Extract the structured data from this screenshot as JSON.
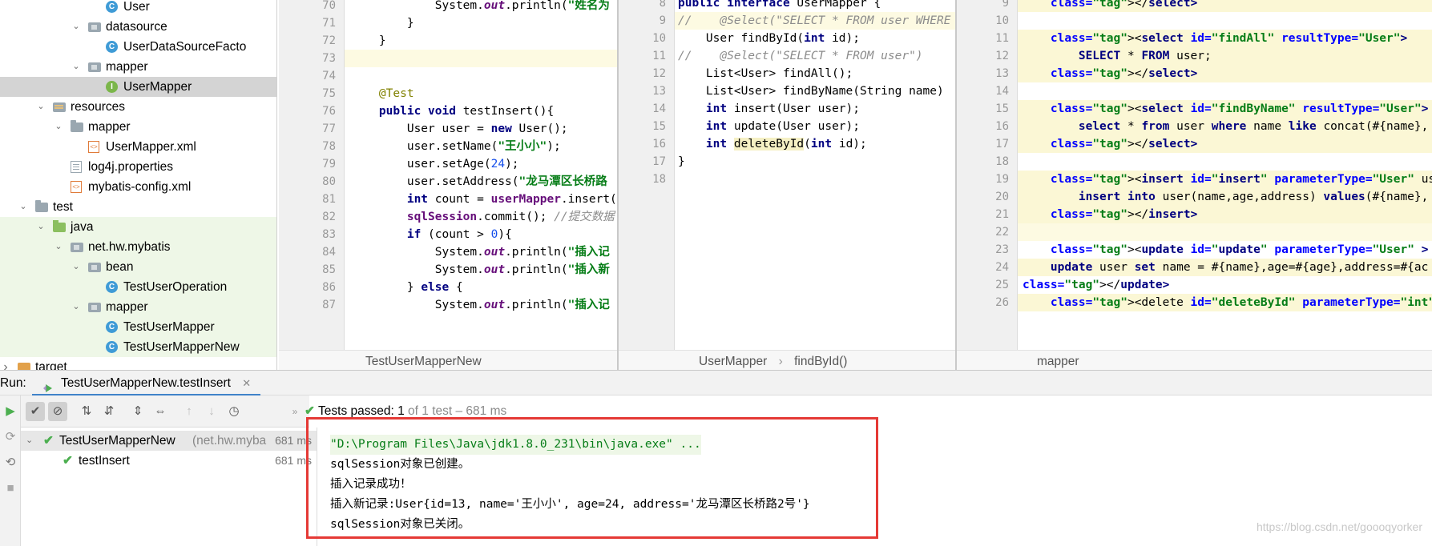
{
  "project_tree": {
    "items": [
      {
        "label": "User",
        "icon": "class-icon",
        "indent": 5,
        "arrow": ""
      },
      {
        "label": "datasource",
        "icon": "package-icon",
        "indent": 4,
        "arrow": "expanded"
      },
      {
        "label": "UserDataSourceFacto",
        "icon": "class-icon",
        "indent": 5,
        "arrow": ""
      },
      {
        "label": "mapper",
        "icon": "package-icon",
        "indent": 4,
        "arrow": "expanded"
      },
      {
        "label": "UserMapper",
        "icon": "interface-icon",
        "indent": 5,
        "arrow": "",
        "selected": true
      },
      {
        "label": "resources",
        "icon": "resources-folder-icon",
        "indent": 2,
        "arrow": "expanded"
      },
      {
        "label": "mapper",
        "icon": "folder-icon",
        "indent": 3,
        "arrow": "expanded"
      },
      {
        "label": "UserMapper.xml",
        "icon": "xml-file-icon",
        "indent": 4,
        "arrow": ""
      },
      {
        "label": "log4j.properties",
        "icon": "properties-file-icon",
        "indent": 3,
        "arrow": ""
      },
      {
        "label": "mybatis-config.xml",
        "icon": "xml-file-icon",
        "indent": 3,
        "arrow": ""
      },
      {
        "label": "test",
        "icon": "folder-icon",
        "indent": 1,
        "arrow": "expanded"
      },
      {
        "label": "java",
        "icon": "test-source-folder-icon",
        "indent": 2,
        "arrow": "expanded",
        "green": true
      },
      {
        "label": "net.hw.mybatis",
        "icon": "package-icon",
        "indent": 3,
        "arrow": "expanded",
        "green": true
      },
      {
        "label": "bean",
        "icon": "package-icon",
        "indent": 4,
        "arrow": "expanded",
        "green": true
      },
      {
        "label": "TestUserOperation",
        "icon": "class-icon",
        "indent": 5,
        "arrow": "",
        "green": true
      },
      {
        "label": "mapper",
        "icon": "package-icon",
        "indent": 4,
        "arrow": "expanded",
        "green": true
      },
      {
        "label": "TestUserMapper",
        "icon": "class-icon",
        "indent": 5,
        "arrow": "",
        "green": true
      },
      {
        "label": "TestUserMapperNew",
        "icon": "class-icon",
        "indent": 5,
        "arrow": "",
        "green": true
      },
      {
        "label": "target",
        "icon": "target-folder-icon",
        "indent": 0,
        "arrow": "collapsed"
      }
    ]
  },
  "editor_test": {
    "tab_name": "TestUserMapperNew",
    "line_numbers": [
      "70",
      "71",
      "72",
      "73",
      "74",
      "75",
      "76",
      "77",
      "78",
      "79",
      "80",
      "81",
      "82",
      "83",
      "84",
      "85",
      "86",
      "87"
    ],
    "lines": [
      "            System.out.println(\"姓名为",
      "        }",
      "    }",
      "",
      "",
      "    @Test",
      "    public void testInsert(){",
      "        User user = new User();",
      "        user.setName(\"王小小\");",
      "        user.setAge(24);",
      "        user.setAddress(\"龙马潭区长桥路",
      "        int count = userMapper.insert(",
      "        sqlSession.commit(); //提交数据",
      "        if (count > 0){",
      "            System.out.println(\"插入记",
      "            System.out.println(\"插入新",
      "        } else {",
      "            System.out.println(\"插入记"
    ]
  },
  "editor_interface": {
    "crumbs": [
      "UserMapper",
      "findById()"
    ],
    "line_numbers": [
      "8",
      "9",
      "10",
      "11",
      "12",
      "13",
      "14",
      "15",
      "16",
      "17",
      "18"
    ],
    "lines": [
      "public interface UserMapper {",
      "//    @Select(\"SELECT * FROM user WHERE",
      "    User findById(int id);",
      "//    @Select(\"SELECT * FROM user\")",
      "    List<User> findAll();",
      "    List<User> findByName(String name)",
      "    int insert(User user);",
      "    int update(User user);",
      "    int deleteById(int id);",
      "}",
      ""
    ]
  },
  "editor_xml": {
    "tab_name": "mapper",
    "line_numbers": [
      "9",
      "10",
      "11",
      "12",
      "13",
      "14",
      "15",
      "16",
      "17",
      "18",
      "19",
      "20",
      "21",
      "22",
      "23",
      "24",
      "25",
      "26"
    ],
    "lines": [
      "    </select>",
      "",
      "    <select id=\"findAll\" resultType=\"User\">",
      "        SELECT * FROM user;",
      "    </select>",
      "",
      "    <select id=\"findByName\" resultType=\"User\">",
      "        select * from user where name like concat(#{name},",
      "    </select>",
      "",
      "    <insert id=\"insert\" parameterType=\"User\" useGeneratedK",
      "        insert into user(name,age,address) values(#{name},",
      "    </insert>",
      "",
      "    <update id=\"update\" parameterType=\"User\" >",
      "    update user set name = #{name},age=#{age},address=#{ac",
      "</update>",
      "    <delete id=\"deleteById\" parameterType=\"int\">"
    ]
  },
  "run": {
    "label": "Run:",
    "tab_label": "TestUserMapperNew.testInsert",
    "status_passed": "Tests passed: 1",
    "status_rest": "of 1 test – 681 ms",
    "test_tree": [
      {
        "name": "TestUserMapperNew",
        "sub": "(net.hw.myba",
        "time": "681 ms"
      },
      {
        "name": "testInsert",
        "sub": "",
        "time": "681 ms"
      }
    ],
    "console": [
      "\"D:\\Program Files\\Java\\jdk1.8.0_231\\bin\\java.exe\" ...",
      "sqlSession对象已创建。",
      "插入记录成功！",
      "插入新记录:User{id=13, name='王小小', age=24, address='龙马潭区长桥路2号'}",
      "sqlSession对象已关闭。"
    ]
  },
  "watermark": "https://blog.csdn.net/goooqyorker",
  "colors": {
    "highlight_box": "#e53935",
    "pass_green": "#4caf50",
    "selection": "#d4d4d4",
    "test_source_bg": "#eef7e7"
  }
}
